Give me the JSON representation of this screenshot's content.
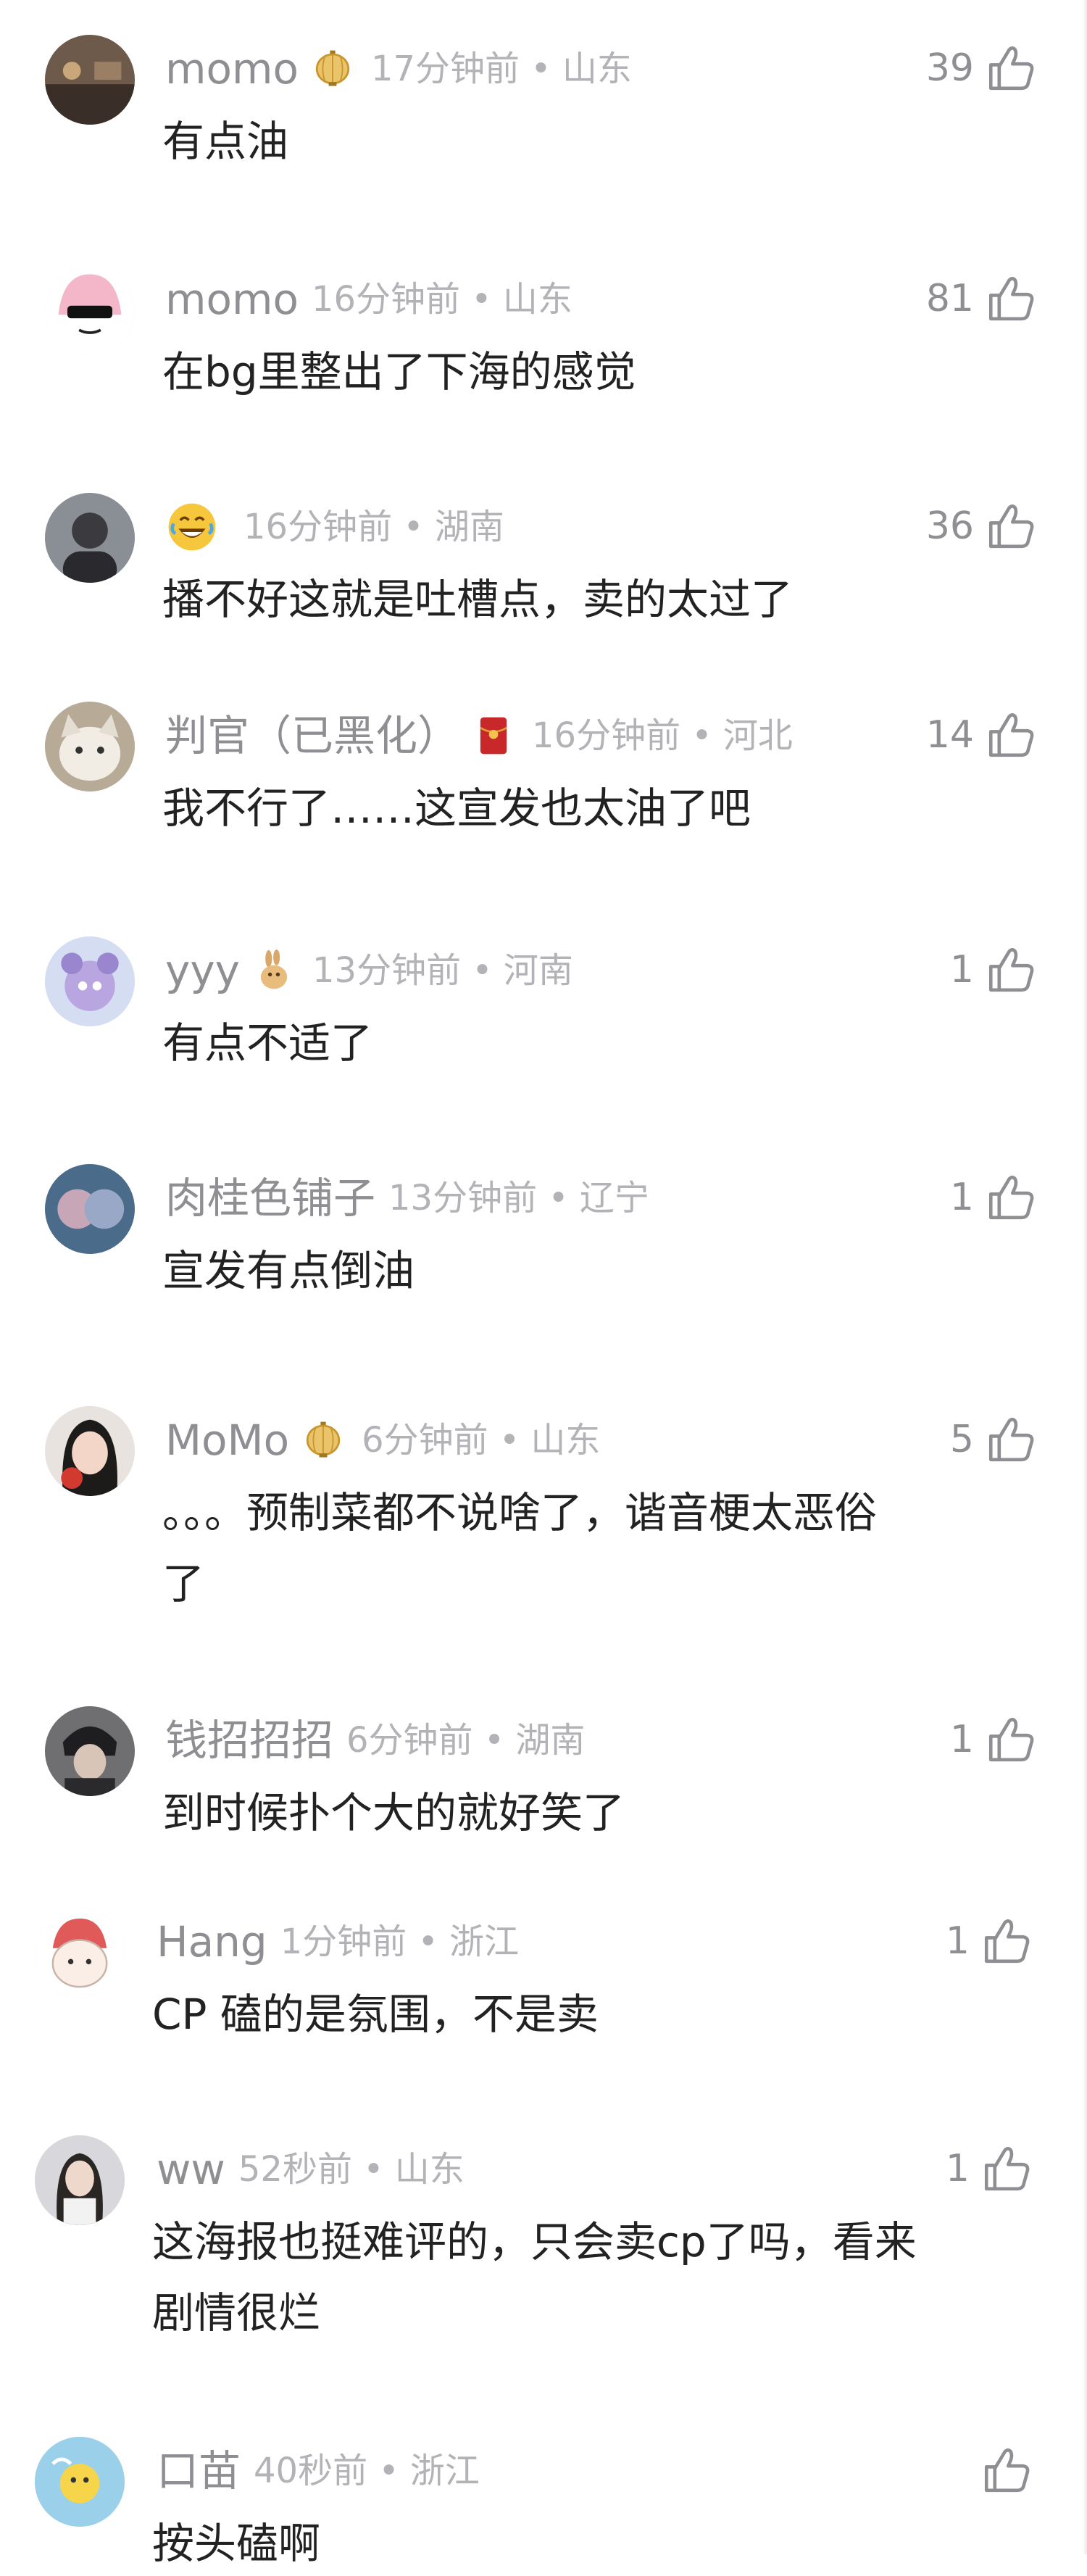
{
  "comments": [
    {
      "user": "momo",
      "time": "17分钟前 • 山东",
      "text": "有点油",
      "likes": "39"
    },
    {
      "user": "momo",
      "time": "16分钟前 • 山东",
      "text": "在bg里整出了下海的感觉",
      "likes": "81"
    },
    {
      "user": "",
      "time": "16分钟前 • 湖南",
      "text": "播不好这就是吐槽点，卖的太过了",
      "likes": "36"
    },
    {
      "user": "判官（已黑化）",
      "time": "16分钟前 • 河北",
      "text": "我不行了……这宣发也太油了吧",
      "likes": "14"
    },
    {
      "user": "yyy",
      "time": "13分钟前 • 河南",
      "text": "有点不适了",
      "likes": "1"
    },
    {
      "user": "肉桂色铺子",
      "time": "13分钟前 • 辽宁",
      "text": "宣发有点倒油",
      "likes": "1"
    },
    {
      "user": "MoMo",
      "time": "6分钟前 • 山东",
      "text_line1": "。。。预制菜都不说啥了，谐音梗太恶俗",
      "text_line2": "了",
      "likes": "5"
    },
    {
      "user": "钱招招招",
      "time": "6分钟前 • 湖南",
      "text": "到时候扑个大的就好笑了",
      "likes": "1"
    },
    {
      "user": "Hang",
      "time": "1分钟前 • 浙江",
      "text": "CP 磕的是氛围，不是卖",
      "likes": "1"
    },
    {
      "user": "ww",
      "time": "52秒前 • 山东",
      "text_line1": "这海报也挺难评的，只会卖cp了吗，看来",
      "text_line2": "剧情很烂",
      "likes": "1"
    },
    {
      "user": "口苗",
      "time": "40秒前 • 浙江",
      "text": "按头磕啊",
      "likes": ""
    }
  ],
  "icons": {
    "like": "thumbs-up-icon",
    "badge_lantern": "lantern-badge-icon",
    "badge_redpacket": "red-envelope-badge-icon",
    "badge_rabbit": "rabbit-badge-icon",
    "emoji_laugh": "laughing-emoji-icon"
  },
  "colors": {
    "name": "#8e8e93",
    "meta": "#b2b2b7",
    "text": "#222222",
    "lantern": "#d8a84a",
    "redpacket": "#c8282a",
    "emoji": "#f6c73c"
  }
}
